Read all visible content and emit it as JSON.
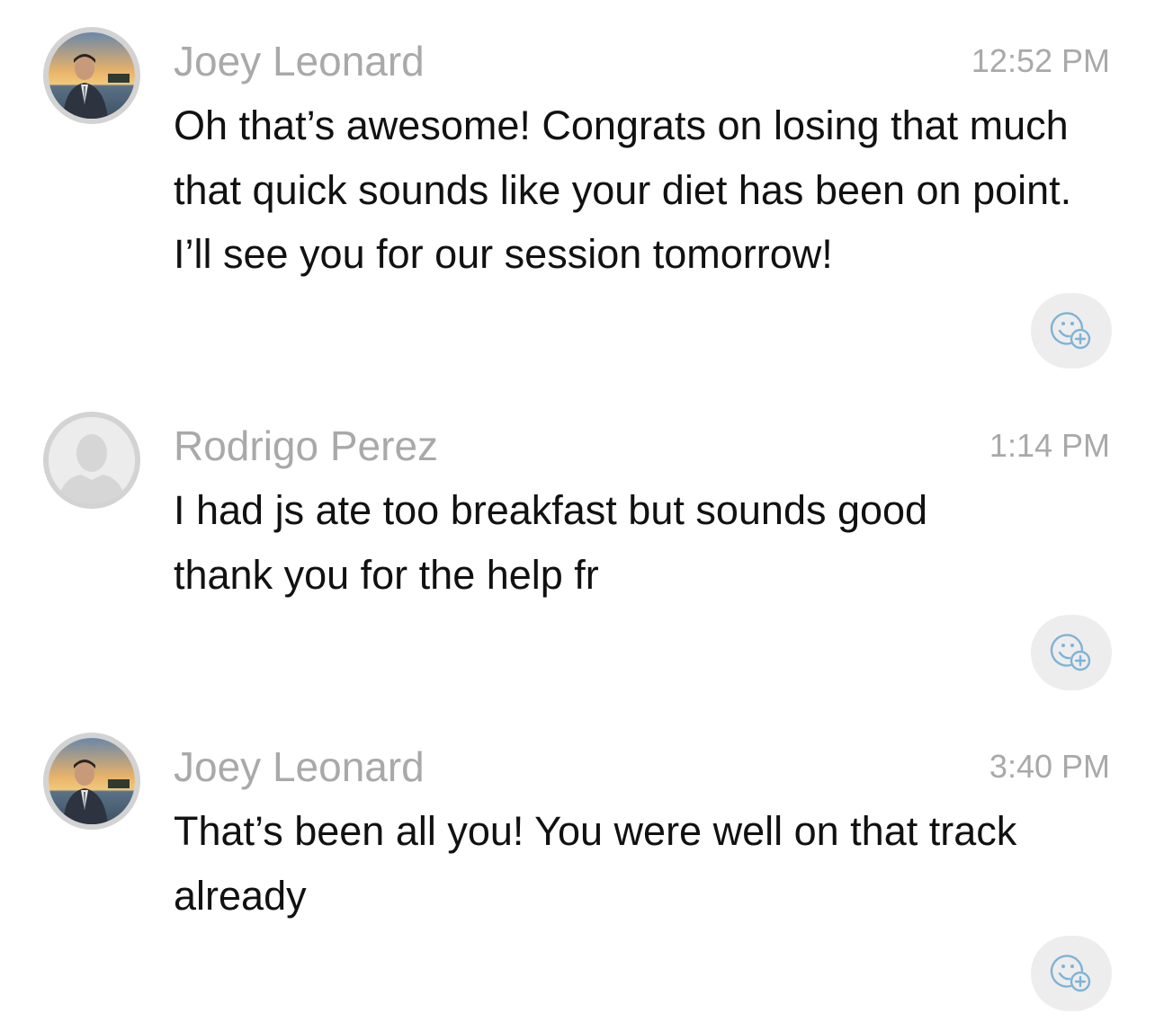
{
  "messages": [
    {
      "sender": "Joey Leonard",
      "time": "12:52 PM",
      "text": "Oh that’s awesome! Congrats on losing that much that quick sounds like your diet has been on point. I’ll see you for our session tomorrow!",
      "avatar": "photo"
    },
    {
      "sender": "Rodrigo Perez",
      "time": "1:14 PM",
      "text": "I had js ate too breakfast but sounds good thank you for the help fr",
      "avatar": "default"
    },
    {
      "sender": "Joey Leonard",
      "time": "3:40 PM",
      "text": "That’s been all you! You were well on that track already",
      "avatar": "photo"
    }
  ],
  "icons": {
    "add_reaction": "add-reaction-icon",
    "default_avatar": "person-silhouette-icon"
  },
  "colors": {
    "meta_text": "#a9a9a9",
    "body_text": "#111111",
    "reaction_icon": "#7fb3d5",
    "reaction_bg": "#ededed"
  }
}
